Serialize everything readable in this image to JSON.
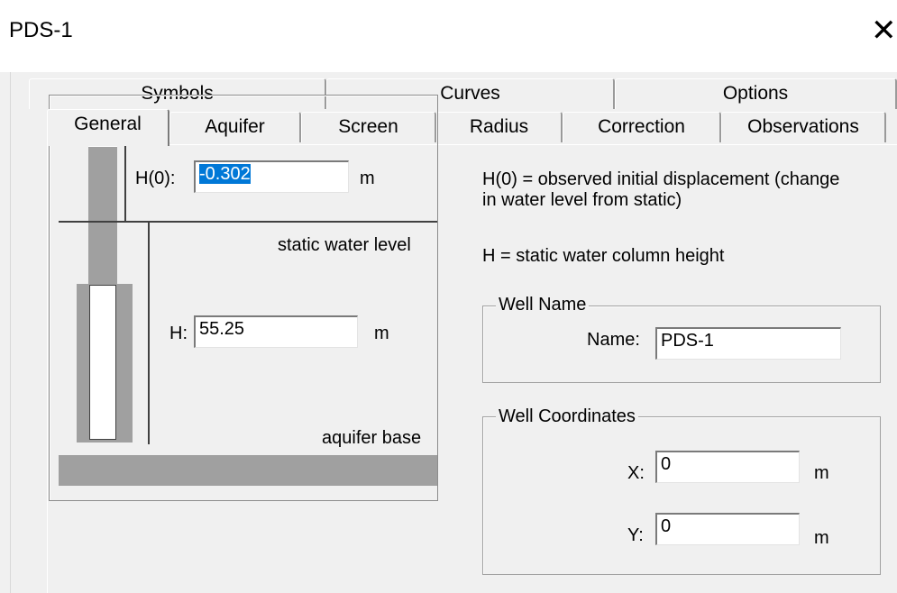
{
  "window": {
    "title": "PDS-1",
    "close_glyph": "✕"
  },
  "tabs": {
    "row1": [
      "Symbols",
      "Curves",
      "Options"
    ],
    "row2": [
      "General",
      "Aquifer",
      "Screen",
      "Radius",
      "Correction",
      "Observations"
    ],
    "active": "General"
  },
  "diagram": {
    "h0_label": "H(0):",
    "h0_value": "-0.302",
    "h0_unit": "m",
    "static_label": "static water level",
    "h_label": "H:",
    "h_value": "55.25",
    "h_unit": "m",
    "base_label": "aquifer base"
  },
  "info": {
    "h0_line1": "H(0) = observed initial displacement (change",
    "h0_line2": "in water level from static)",
    "h_desc": "H = static water column height"
  },
  "well_name": {
    "legend": "Well Name",
    "label": "Name:",
    "value": "PDS-1"
  },
  "well_coordinates": {
    "legend": "Well Coordinates",
    "x_label": "X:",
    "x_value": "0",
    "x_unit": "m",
    "y_label": "Y:",
    "y_value": "0",
    "y_unit": "m"
  },
  "colors": {
    "pipe": "#a0a0a0",
    "selection": "#0078d7",
    "dialog_bg": "#f0f0f0"
  }
}
